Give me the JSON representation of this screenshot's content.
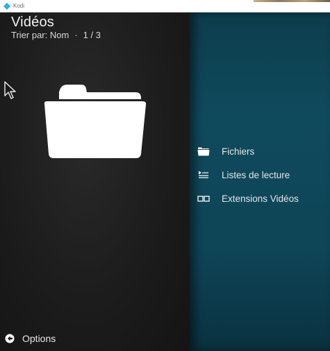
{
  "window": {
    "title": "Kodi"
  },
  "header": {
    "title": "Vidéos",
    "sort_label": "Trier par: Nom",
    "separator": "·",
    "page": "1 / 3"
  },
  "menu": {
    "items": [
      {
        "label": "Fichiers",
        "icon": "folder-icon"
      },
      {
        "label": "Listes de lecture",
        "icon": "playlist-icon"
      },
      {
        "label": "Extensions Vidéos",
        "icon": "addons-icon"
      }
    ]
  },
  "footer": {
    "options_label": "Options",
    "icon": "options-icon"
  },
  "colors": {
    "accent": "#0f4a5c",
    "text": "#e6e6e6",
    "background": "#1c1c1c"
  }
}
